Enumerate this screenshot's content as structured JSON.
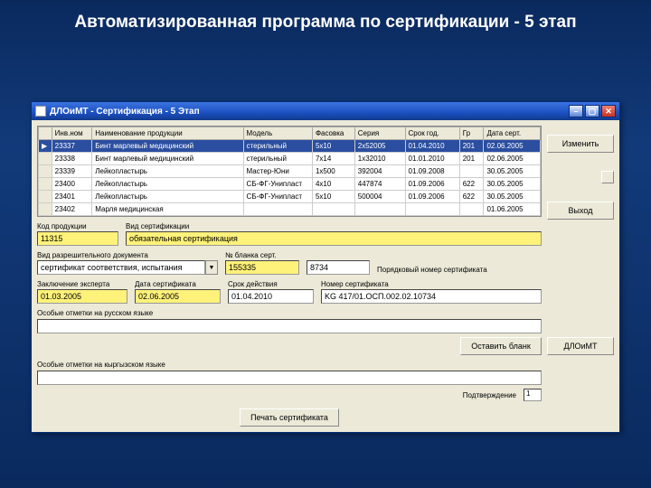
{
  "slideTitle": "Автоматизированная программа по сертификации - 5 этап",
  "window": {
    "title": "ДЛОиМТ - Сертификация - 5 Этап"
  },
  "grid": {
    "headers": [
      "Инв.ном",
      "Наименование продукции",
      "Модель",
      "Фасовка",
      "Серия",
      "Срок год.",
      "Гр",
      "Дата серт."
    ],
    "rows": [
      {
        "c": [
          "23337",
          "Бинт марлевый медицинский",
          "стерильный",
          "5x10",
          "2x52005",
          "01.04.2010",
          "201",
          "02.06.2005"
        ],
        "sel": true
      },
      {
        "c": [
          "23338",
          "Бинт марлевый медицинский",
          "стерильный",
          "7x14",
          "1x32010",
          "01.01.2010",
          "201",
          "02.06.2005"
        ]
      },
      {
        "c": [
          "23339",
          "Лейкопластырь",
          "Мастер-Юни",
          "1x500",
          "392004",
          "01.09.2008",
          "",
          "30.05.2005"
        ]
      },
      {
        "c": [
          "23400",
          "Лейкопластырь",
          "СБ-ФГ-Унипласт",
          "4x10",
          "447874",
          "01.09.2006",
          "622",
          "30.05.2005"
        ]
      },
      {
        "c": [
          "23401",
          "Лейкопластырь",
          "СБ-ФГ-Унипласт",
          "5x10",
          "500004",
          "01.09.2006",
          "622",
          "30.05.2005"
        ]
      },
      {
        "c": [
          "23402",
          "Марля медицинская",
          "",
          "",
          "",
          "",
          "",
          "01.06.2005"
        ]
      }
    ]
  },
  "buttons": {
    "change": "Изменить",
    "exit": "Выход",
    "dloimt": "ДЛОиМТ",
    "leaveBlank": "Оставить бланк",
    "confirm": "Подтверждение",
    "print": "Печать сертификата"
  },
  "labels": {
    "prodCode": "Код продукции",
    "certType": "Вид сертификации",
    "docType": "Вид разрешительного документа",
    "blankNo": "№ бланка серт.",
    "serialCert": "Порядковый номер сертификата",
    "expertConcl": "Заключение эксперта",
    "certDate": "Дата сертификата",
    "expiry": "Срок действия",
    "certNo": "Номер сертификата",
    "notesRu": "Особые отметки на русском языке",
    "notesKg": "Особые отметки на кыргызском языке"
  },
  "values": {
    "prodCode": "11315",
    "certType": "обязательная сертификация",
    "docType": "сертификат соответствия, испытания",
    "blankNo": "155335",
    "serialCert": "8734",
    "expertConcl": "01.03.2005",
    "certDate": "02.06.2005",
    "expiry": "01.04.2010",
    "certNo": "KG 417/01.ОСП.002.02.10734",
    "confirmNum": "1"
  }
}
